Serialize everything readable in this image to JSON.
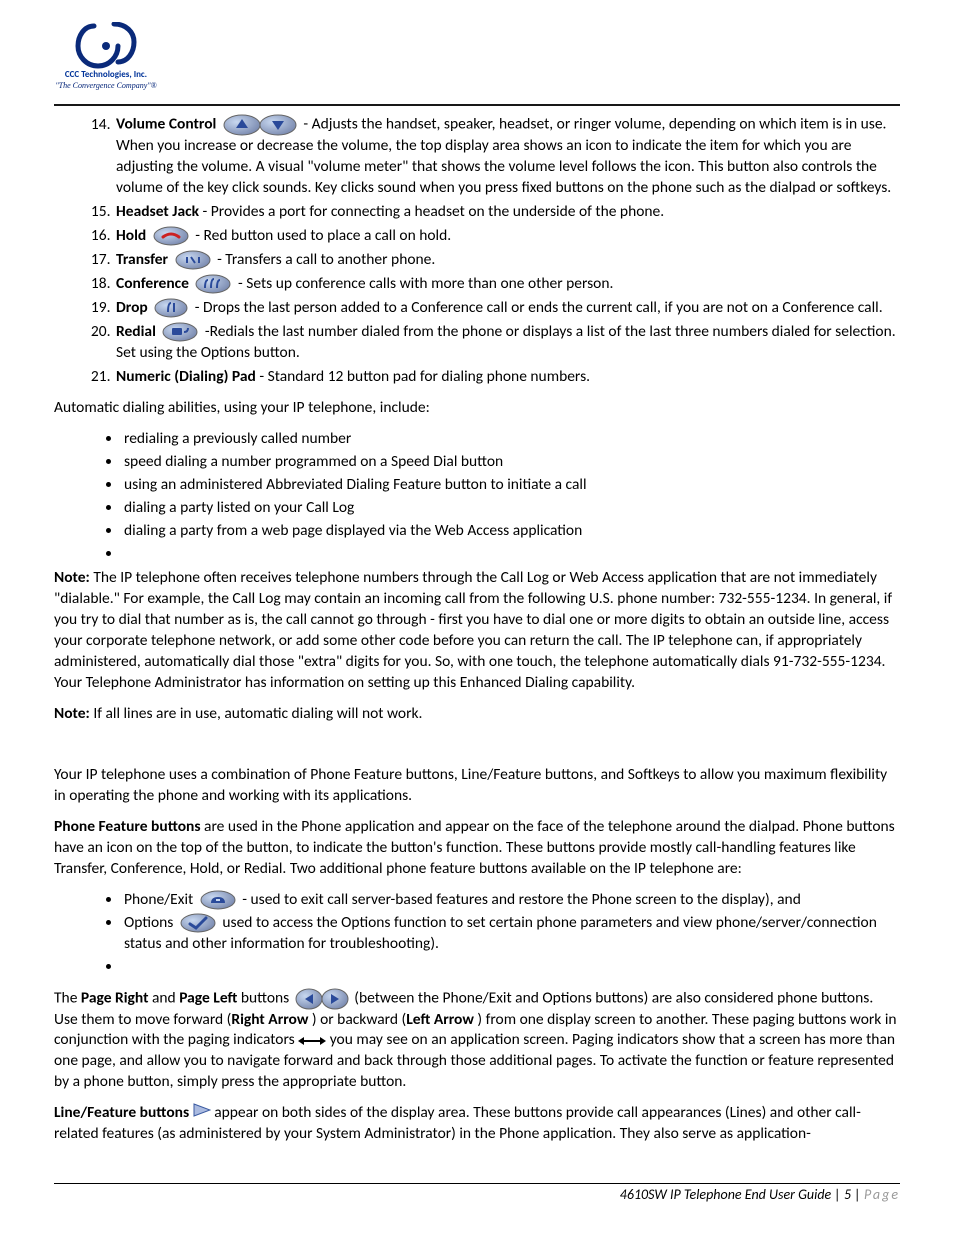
{
  "header": {
    "company": "CCC Technologies, Inc.",
    "tagline": "\"The Convergence Company\"®"
  },
  "list14_21": [
    {
      "n": "14",
      "label": "Volume Control",
      "icon": "volume-buttons",
      "text": "- Adjusts the handset, speaker, headset, or ringer volume, depending on which item is in use. When you increase or decrease the volume, the top display area shows an icon to indicate the item for which you are adjusting the volume. A visual \"volume meter\" that shows the volume level follows the icon. This button also controls the volume of the key click sounds. Key clicks sound when you press fixed buttons on the phone such as the dialpad or softkeys."
    },
    {
      "n": "15",
      "label": "Headset Jack",
      "text": " - Provides a port for connecting a headset on the underside of the phone."
    },
    {
      "n": "16",
      "label": "Hold",
      "icon": "hold-button",
      "text": "- Red button used to place a call on hold."
    },
    {
      "n": "17",
      "label": "Transfer",
      "icon": "transfer-button",
      "text": "- Transfers a call to another phone."
    },
    {
      "n": "18",
      "label": "Conference",
      "icon": "conference-button",
      "text": "- Sets up conference calls with more than one other person."
    },
    {
      "n": "19",
      "label": "Drop",
      "icon": "drop-button",
      "text": "- Drops the last person added to a Conference call or ends the current call, if you are not on a Conference call."
    },
    {
      "n": "20",
      "label": "Redial",
      "icon": "redial-button",
      "text": "-Redials the last number dialed from the phone or displays a list of the last three numbers dialed for selection. Set using the Options button."
    },
    {
      "n": "21",
      "label": "Numeric (Dialing) Pad",
      "text": " - Standard 12 button pad for dialing phone numbers."
    }
  ],
  "autoDialingIntro": "Automatic dialing abilities, using your IP telephone, include:",
  "autoDialingBullets": [
    "redialing a previously called number",
    "speed dialing a number programmed on a Speed Dial button",
    "using an administered Abbreviated Dialing Feature button to initiate a call",
    "dialing a party listed on your Call Log",
    "dialing a party from a web page displayed via the Web Access application",
    ""
  ],
  "note1": " The IP telephone often receives telephone numbers through the Call Log or Web Access application that are not immediately \"dialable.\" For example, the Call Log may contain an incoming call from the following U.S. phone number: 732-555-1234. In general, if you try to dial that number as is, the call cannot go through - first you have to dial one or more digits to obtain an outside line, access your corporate telephone network, or add some other code before you can return the call. The IP telephone can, if appropriately administered, automatically dial those \"extra\" digits for you. So, with one touch, the telephone automatically dials 91-732-555-1234. Your Telephone Administrator has information on setting up this Enhanced Dialing capability.",
  "noteLabel": "Note:",
  "note2": " If all lines are in use, automatic dialing will not work.",
  "featuresIntro": "Your IP telephone uses a combination of Phone Feature buttons, Line/Feature buttons, and Softkeys to allow you maximum flexibility in operating the phone and working with its applications.",
  "phoneFeatureBtnsLabel": "Phone Feature buttons",
  "phoneFeatureBtnsText": " are used in the Phone application and appear on the face of the telephone around the dialpad. Phone buttons have an icon on the top of the button, to indicate the button's function. These buttons provide mostly call-handling features like Transfer, Conference, Hold, or Redial. Two additional phone feature buttons available on the IP telephone are:",
  "pfBullets": [
    {
      "label": "Phone/Exit",
      "icon": "phone-exit-button",
      "text": "- used to exit call server-based features and restore the Phone screen to the display), and"
    },
    {
      "label": "Options",
      "icon": "options-button",
      "text": "used to access the Options function to set certain phone parameters and view phone/server/connection status and other information for troubleshooting)."
    },
    {
      "label": "",
      "text": ""
    }
  ],
  "pageRightLeft": {
    "pre": "The ",
    "b1": "Page Right",
    "mid1": " and ",
    "b2": "Page Left",
    "mid2": " buttons ",
    "afterIcon": "(between the Phone/Exit and Options buttons) are also considered phone buttons. Use them to move forward (",
    "b3": "Right Arrow",
    "mid3": " ) or backward (",
    "b4": "Left Arrow",
    "mid4": " ) from one display screen to another. These paging buttons work in conjunction with the paging indicators ",
    "afterArrow": "you may see on an application screen. Paging indicators show that a screen has more than one page, and allow you to navigate forward and back through those additional pages. To activate the function or feature represented by a phone button, simply press the appropriate button."
  },
  "lineFeature": {
    "label": "Line/Feature buttons ",
    "text": "appear on both sides of the display area. These buttons provide call appearances (Lines) and other call-related features (as administered by your System Administrator) in the Phone application. They also serve as application-"
  },
  "footer": {
    "doc": "4610SW IP Telephone End User Guide",
    "pageNum": "5",
    "pageWord": "Page"
  }
}
